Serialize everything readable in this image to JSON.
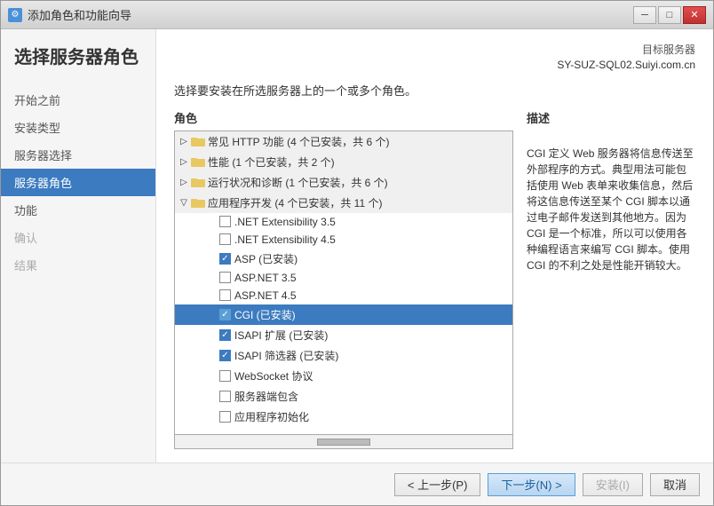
{
  "window": {
    "title": "添加角色和功能向导",
    "icon": "⚙"
  },
  "title_controls": {
    "minimize": "─",
    "restore": "□",
    "close": "✕"
  },
  "target_server": {
    "label": "目标服务器",
    "name": "SY-SUZ-SQL02.Suiyi.com.cn"
  },
  "page_title": "选择服务器角色",
  "sidebar": {
    "items": [
      {
        "label": "开始之前",
        "state": "normal"
      },
      {
        "label": "安装类型",
        "state": "normal"
      },
      {
        "label": "服务器选择",
        "state": "normal"
      },
      {
        "label": "服务器角色",
        "state": "active"
      },
      {
        "label": "功能",
        "state": "normal"
      },
      {
        "label": "确认",
        "state": "disabled"
      },
      {
        "label": "结果",
        "state": "disabled"
      }
    ]
  },
  "content": {
    "description": "选择要安装在所选服务器上的一个或多个角色。",
    "roles_header": "角色",
    "description_header": "描述",
    "description_text": "CGI 定义 Web 服务器将信息传送至外部程序的方式。典型用法可能包括使用 Web 表单来收集信息，然后将这信息传送至某个 CGI 脚本以通过电子邮件发送到其他地方。因为 CGI 是一个标准，所以可以使用各种编程语言来编写 CGI 脚本。使用 CGI 的不利之处是性能开销较大。"
  },
  "roles": [
    {
      "id": "http-common",
      "label": "常见 HTTP 功能 (4 个已安装，共 6 个)",
      "indent": 1,
      "type": "group",
      "expanded": false,
      "checked": "partial",
      "icon": "folder"
    },
    {
      "id": "perf",
      "label": "性能 (1 个已安装，共 2 个)",
      "indent": 1,
      "type": "group",
      "expanded": false,
      "checked": "partial",
      "icon": "folder"
    },
    {
      "id": "health",
      "label": "运行状况和诊断 (1 个已安装，共 6 个)",
      "indent": 1,
      "type": "group",
      "expanded": false,
      "checked": "partial",
      "icon": "folder"
    },
    {
      "id": "appdev",
      "label": "应用程序开发 (4 个已安装，共 11 个)",
      "indent": 1,
      "type": "group",
      "expanded": true,
      "checked": "partial",
      "icon": "folder"
    },
    {
      "id": "net35",
      "label": ".NET Extensibility 3.5",
      "indent": 3,
      "type": "item",
      "checked": false
    },
    {
      "id": "net45",
      "label": ".NET Extensibility 4.5",
      "indent": 3,
      "type": "item",
      "checked": false
    },
    {
      "id": "asp",
      "label": "ASP (已安装)",
      "indent": 3,
      "type": "item",
      "checked": true
    },
    {
      "id": "aspnet35",
      "label": "ASP.NET 3.5",
      "indent": 3,
      "type": "item",
      "checked": false
    },
    {
      "id": "aspnet45",
      "label": "ASP.NET 4.5",
      "indent": 3,
      "type": "item",
      "checked": false
    },
    {
      "id": "cgi",
      "label": "CGI (已安装)",
      "indent": 3,
      "type": "item",
      "checked": true,
      "selected": true
    },
    {
      "id": "isapi-ext",
      "label": "ISAPI 扩展 (已安装)",
      "indent": 3,
      "type": "item",
      "checked": true
    },
    {
      "id": "isapi-filter",
      "label": "ISAPI 筛选器 (已安装)",
      "indent": 3,
      "type": "item",
      "checked": true
    },
    {
      "id": "websocket",
      "label": "WebSocket 协议",
      "indent": 3,
      "type": "item",
      "checked": false
    },
    {
      "id": "server-side-include",
      "label": "服务器端包含",
      "indent": 3,
      "type": "item",
      "checked": false
    },
    {
      "id": "app-init",
      "label": "应用程序初始化",
      "indent": 3,
      "type": "item",
      "checked": false
    }
  ],
  "footer": {
    "prev_label": "< 上一步(P)",
    "next_label": "下一步(N) >",
    "install_label": "安装(I)",
    "cancel_label": "取消"
  }
}
